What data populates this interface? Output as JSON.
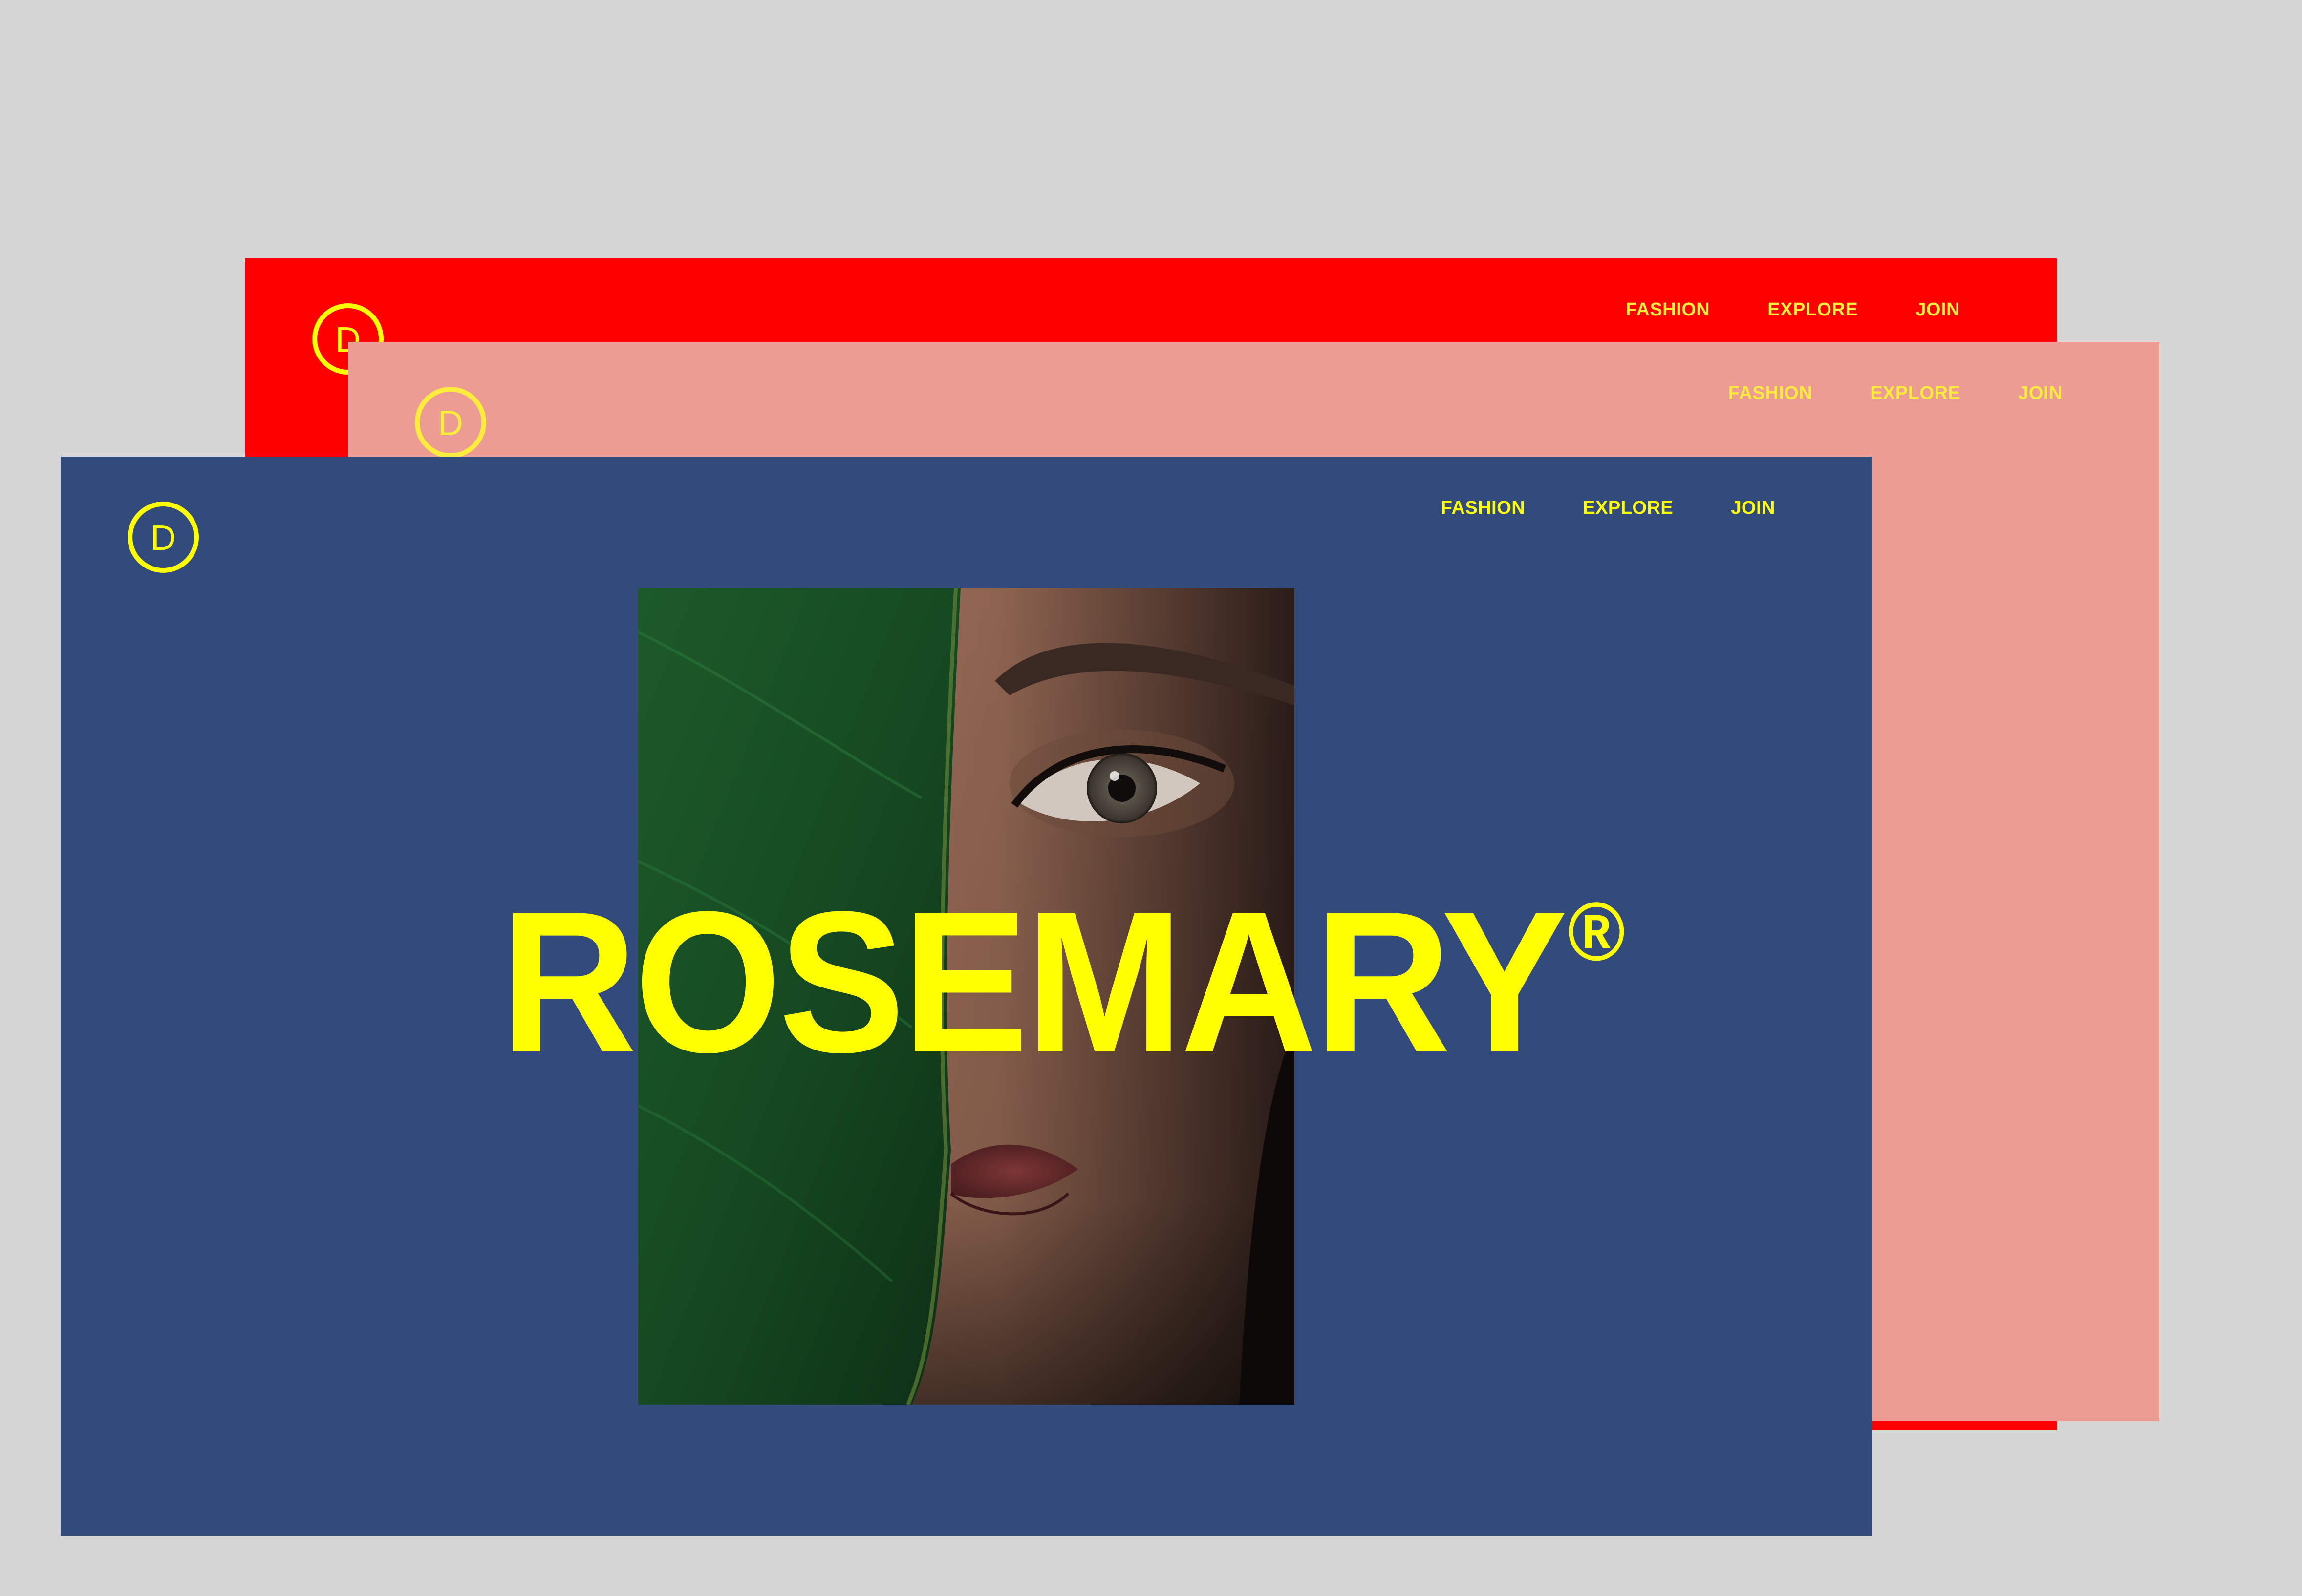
{
  "brand": {
    "logo_icon": "d-circle-logo-icon",
    "logo_letter": "D",
    "accent_color": "#ffff00"
  },
  "cards": {
    "red": {
      "background": "#ff0000",
      "nav": [
        "FASHION",
        "EXPLORE",
        "JOIN"
      ]
    },
    "pink": {
      "background": "#ec9c93",
      "nav": [
        "FASHION",
        "EXPLORE",
        "JOIN"
      ]
    },
    "blue": {
      "background": "#334b7a",
      "nav": [
        "FASHION",
        "EXPLORE",
        "JOIN"
      ],
      "headline": "ROSEMARY",
      "headline_mark": "®",
      "hero_image": "woman-face-behind-leaf-photo"
    }
  }
}
